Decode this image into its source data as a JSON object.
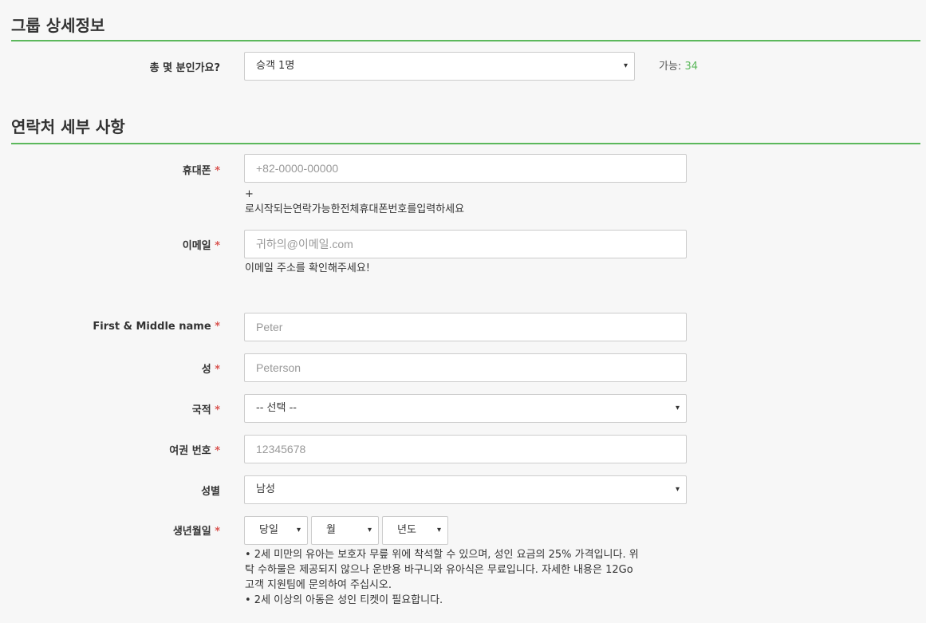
{
  "group": {
    "title": "그룹 상세정보",
    "pax_label": "총 몇 분인가요?",
    "pax_value": "승객 1명",
    "avail_label": "가능:",
    "avail_value": "34"
  },
  "contact": {
    "title": "연락처 세부 사항",
    "phone_label": "휴대폰",
    "phone_placeholder": "+82-0000-00000",
    "phone_help_1": "+",
    "phone_help_2": "로시작되는연락가능한전체휴대폰번호를입력하세요",
    "email_label": "이메일",
    "email_placeholder": "귀하의@이메일.com",
    "email_help": "이메일 주소를 확인해주세요!",
    "first_label": "First & Middle name",
    "first_placeholder": "Peter",
    "last_label": "성",
    "last_placeholder": "Peterson",
    "nation_label": "국적",
    "nation_value": "-- 선택 --",
    "passport_label": "여권 번호",
    "passport_placeholder": "12345678",
    "gender_label": "성별",
    "gender_value": "남성",
    "dob_label": "생년월일",
    "dob_day": "당일",
    "dob_month": "월",
    "dob_year": "년도",
    "note_1": "• 2세 미만의 유아는 보호자 무릎 위에 착석할 수 있으며, 성인 요금의 25% 가격입니다. 위",
    "note_2": "탁 수하물은 제공되지 않으나 운반용 바구니와 유아식은 무료입니다. 자세한 내용은 12Go",
    "note_3": "고객 지원팀에 문의하여 주십시오.",
    "note_4": "• 2세 이상의 아동은 성인 티켓이 필요합니다."
  },
  "required_mark": "*",
  "caret": "▾"
}
